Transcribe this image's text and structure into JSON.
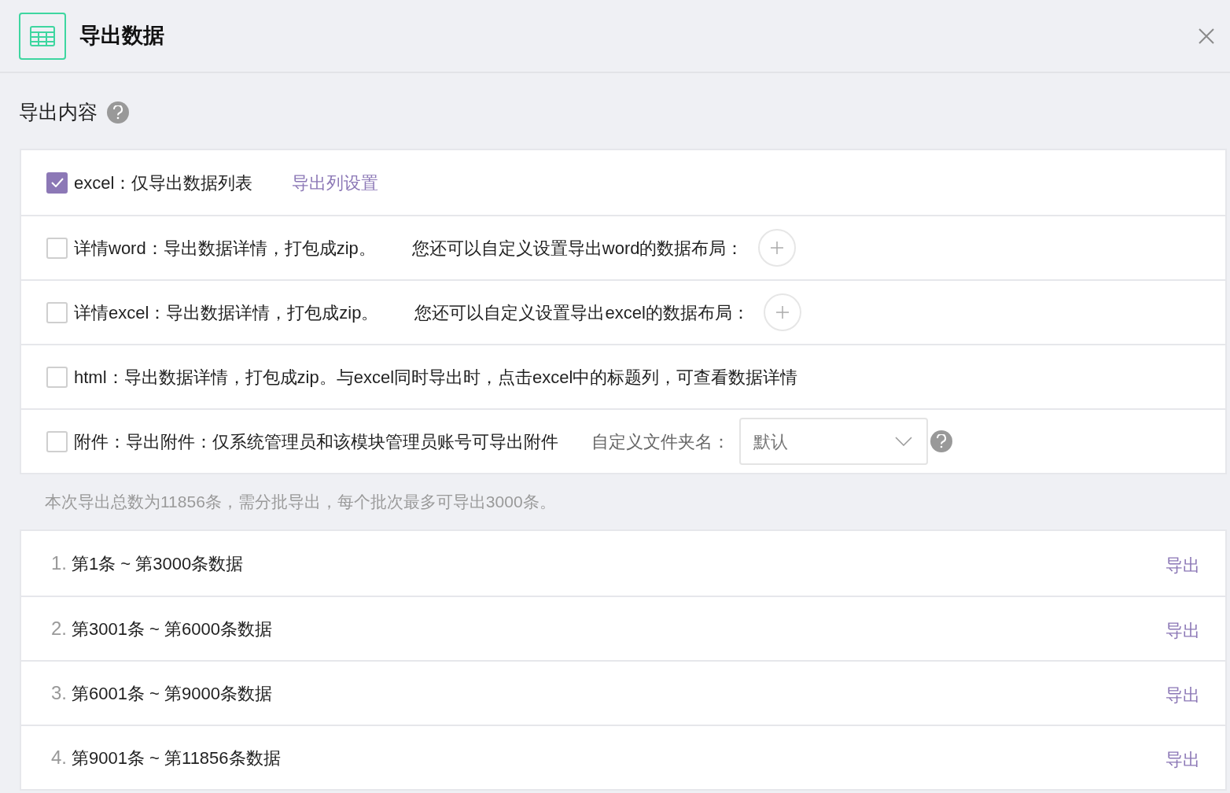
{
  "dialog": {
    "title": "导出数据"
  },
  "section": {
    "title": "导出内容"
  },
  "options": [
    {
      "kind": "link",
      "checked": true,
      "label": "excel：仅导出数据列表",
      "link": "导出列设置"
    },
    {
      "kind": "layout",
      "checked": false,
      "label": "详情word：导出数据详情，打包成zip。",
      "extra": "您还可以自定义设置导出word的数据布局："
    },
    {
      "kind": "layout",
      "checked": false,
      "label": "详情excel：导出数据详情，打包成zip。",
      "extra": "您还可以自定义设置导出excel的数据布局："
    },
    {
      "kind": "plain",
      "checked": false,
      "label": "html：导出数据详情，打包成zip。与excel同时导出时，点击excel中的标题列，可查看数据详情"
    },
    {
      "kind": "folder",
      "checked": false,
      "label": "附件：导出附件：仅系统管理员和该模块管理员账号可导出附件",
      "extra": "自定义文件夹名：",
      "select": "默认"
    }
  ],
  "note": "本次导出总数为11856条，需分批导出，每个批次最多可导出3000条。",
  "batches": [
    {
      "number": "1.",
      "label": "第1条 ~ 第3000条数据",
      "action": "导出"
    },
    {
      "number": "2.",
      "label": "第3001条 ~ 第6000条数据",
      "action": "导出"
    },
    {
      "number": "3.",
      "label": "第6001条 ~ 第9000条数据",
      "action": "导出"
    },
    {
      "number": "4.",
      "label": "第9001条 ~ 第11856条数据",
      "action": "导出"
    }
  ]
}
